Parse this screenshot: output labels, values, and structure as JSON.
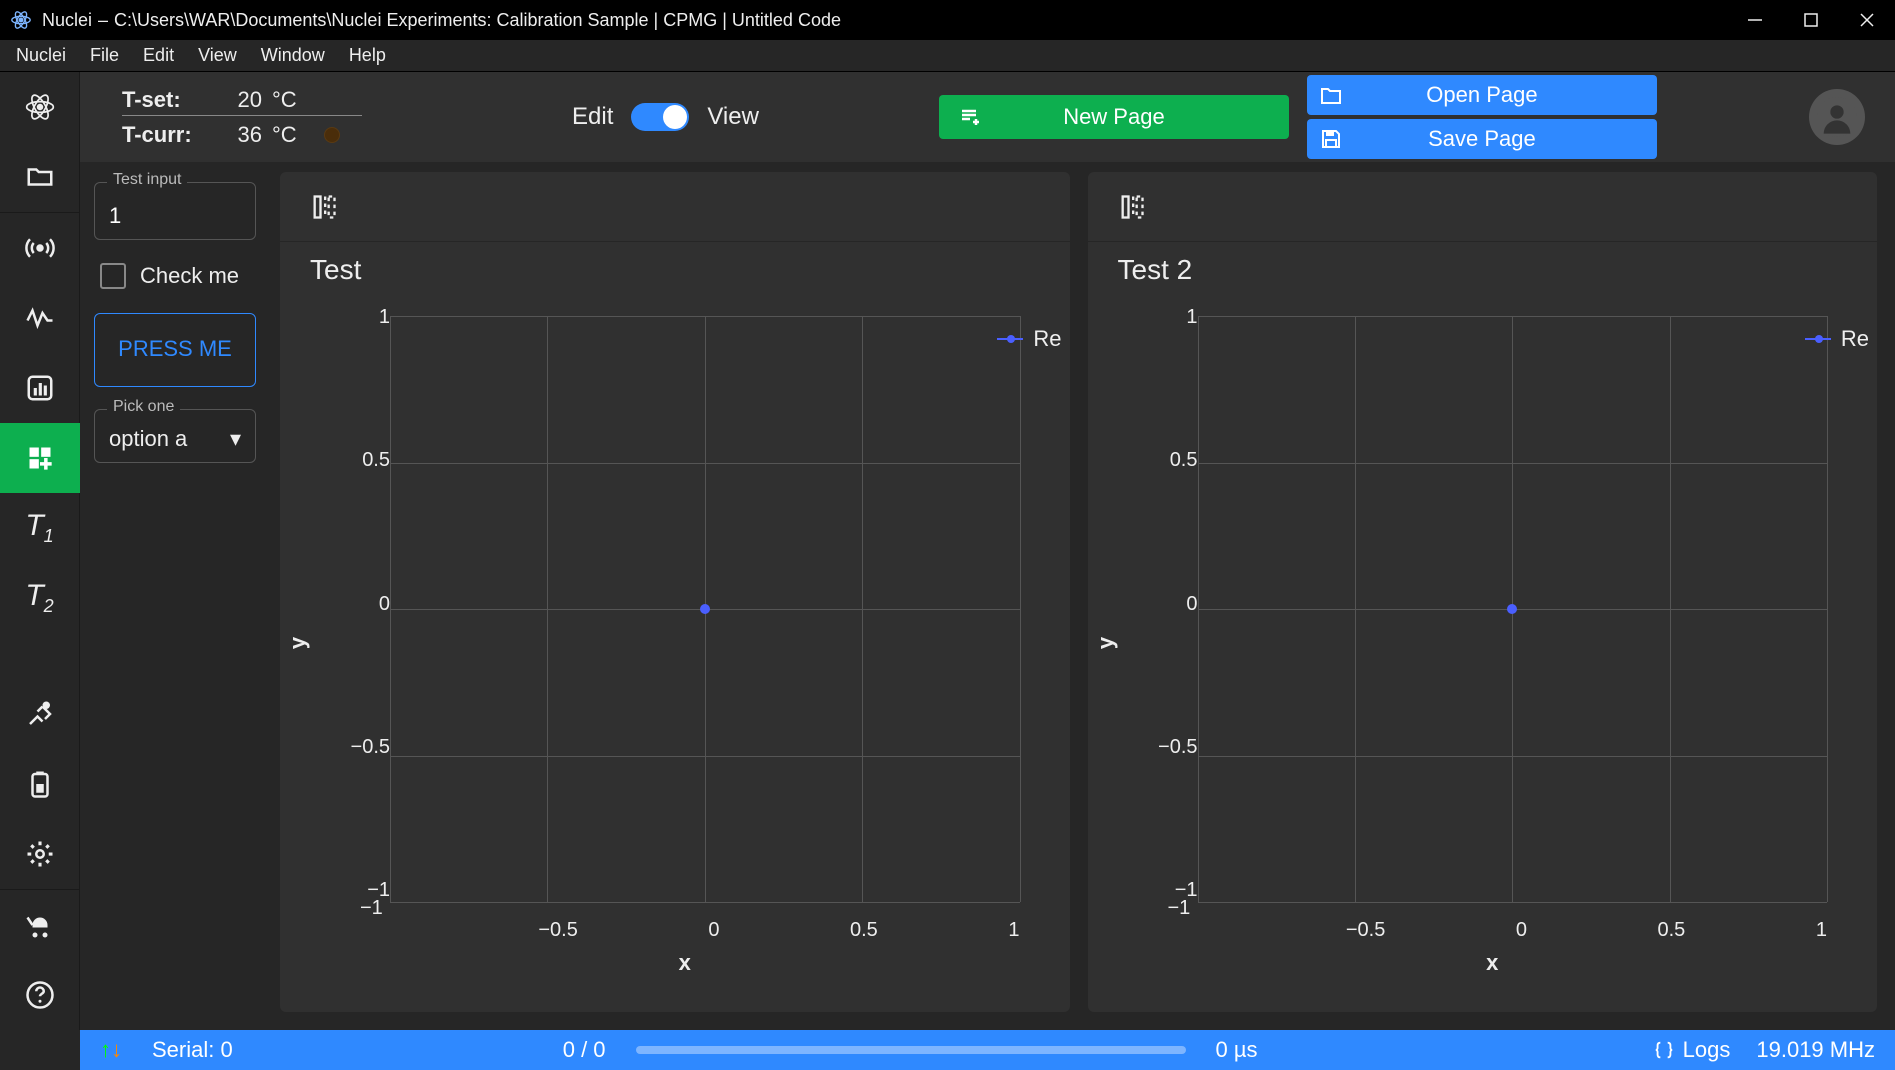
{
  "titlebar": {
    "app": "Nuclei",
    "path_sep": "–",
    "path": "C:\\Users\\WAR\\Documents\\Nuclei Experiments: Calibration Sample | CPMG | Untitled Code"
  },
  "menubar": [
    "Nuclei",
    "File",
    "Edit",
    "View",
    "Window",
    "Help"
  ],
  "sidebar": {
    "icons": [
      {
        "name": "atom-icon"
      },
      {
        "name": "folder-icon"
      },
      {
        "name": "signal-icon"
      },
      {
        "name": "waveform-icon"
      },
      {
        "name": "bar-chart-icon"
      },
      {
        "name": "widgets-icon",
        "active": true
      },
      {
        "name": "t1-icon",
        "label": "T",
        "sub": "1"
      },
      {
        "name": "t2-icon",
        "label": "T",
        "sub": "2"
      }
    ],
    "bottom_icons": [
      {
        "name": "dig-icon"
      },
      {
        "name": "battery-icon"
      },
      {
        "name": "settings-icon"
      },
      {
        "name": "stroller-icon"
      },
      {
        "name": "help-icon"
      }
    ]
  },
  "toolbar": {
    "t_set_label": "T-set:",
    "t_set_val": "20",
    "t_set_unit": "°C",
    "t_curr_label": "T-curr:",
    "t_curr_val": "36",
    "t_curr_unit": "°C",
    "edit_label": "Edit",
    "view_label": "View",
    "new_page": "New Page",
    "open_page": "Open Page",
    "save_page": "Save Page"
  },
  "params": {
    "test_input_label": "Test input",
    "test_input_value": "1",
    "check_label": "Check me",
    "press_me": "PRESS ME",
    "pick_one_label": "Pick one",
    "pick_one_value": "option a"
  },
  "charts": [
    {
      "title": "Test"
    },
    {
      "title": "Test 2"
    }
  ],
  "chart_data": [
    {
      "type": "scatter",
      "title": "Test",
      "xlabel": "x",
      "ylabel": "y",
      "xlim": [
        -1,
        1
      ],
      "ylim": [
        -1,
        1
      ],
      "x_ticks": [
        -1,
        -0.5,
        0,
        0.5,
        1
      ],
      "y_ticks": [
        -1,
        -0.5,
        0,
        0.5,
        1
      ],
      "series": [
        {
          "name": "Re",
          "x": [
            0
          ],
          "y": [
            0
          ]
        }
      ]
    },
    {
      "type": "scatter",
      "title": "Test 2",
      "xlabel": "x",
      "ylabel": "y",
      "xlim": [
        -1,
        1
      ],
      "ylim": [
        -1,
        1
      ],
      "x_ticks": [
        -1,
        -0.5,
        0,
        0.5,
        1
      ],
      "y_ticks": [
        -1,
        -0.5,
        0,
        0.5,
        1
      ],
      "series": [
        {
          "name": "Re",
          "x": [
            0
          ],
          "y": [
            0
          ]
        }
      ]
    }
  ],
  "statusbar": {
    "serial": "Serial: 0",
    "progress_count": "0 / 0",
    "duration": "0 µs",
    "logs": "Logs",
    "freq": "19.019 MHz"
  },
  "axisticks": {
    "y": [
      "1",
      "0.5",
      "0",
      "−0.5",
      "−1"
    ],
    "x": [
      "−1",
      "−0.5",
      "0",
      "0.5",
      "1"
    ]
  },
  "legend_name": "Re"
}
